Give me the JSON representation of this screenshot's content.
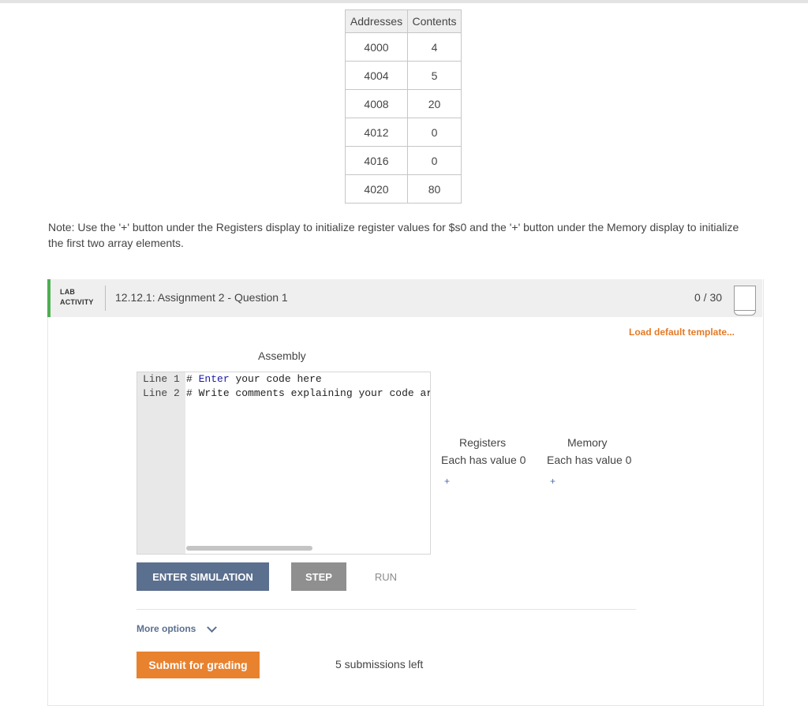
{
  "memory_table": {
    "headers": [
      "Addresses",
      "Contents"
    ],
    "rows": [
      {
        "address": "4000",
        "content": "4"
      },
      {
        "address": "4004",
        "content": "5"
      },
      {
        "address": "4008",
        "content": "20"
      },
      {
        "address": "4012",
        "content": "0"
      },
      {
        "address": "4016",
        "content": "0"
      },
      {
        "address": "4020",
        "content": "80"
      }
    ]
  },
  "note": "Note: Use the '+' button under the Registers display to initialize register values for $s0 and the '+' button under the Memory display to initialize the first two array elements.",
  "activity": {
    "tag_line1": "LAB",
    "tag_line2": "ACTIVITY",
    "title": "12.12.1: Assignment 2 - Question 1",
    "score": "0 / 30",
    "accent_color": "#4caf50"
  },
  "load_template": "Load default template...",
  "editor": {
    "label": "Assembly",
    "lines": [
      {
        "number": "Line 1",
        "hash": "#",
        "keyword": "Enter",
        "rest": "your code here"
      },
      {
        "number": "Line 2",
        "hash": "#",
        "keyword": "",
        "rest": "Write comments explaining your code ar"
      }
    ]
  },
  "registers": {
    "title": "Registers",
    "value_text": "Each has value 0",
    "add_icon": "+"
  },
  "memory": {
    "title": "Memory",
    "value_text": "Each has value 0",
    "add_icon": "+"
  },
  "buttons": {
    "enter_simulation": "ENTER SIMULATION",
    "step": "STEP",
    "run": "RUN",
    "submit": "Submit for grading"
  },
  "more_options": "More options",
  "submissions_left": "5 submissions left",
  "colors": {
    "submit": "#e8822f",
    "enter": "#5b6f8f",
    "step": "#8f8f8f",
    "link_orange": "#e57a25"
  }
}
